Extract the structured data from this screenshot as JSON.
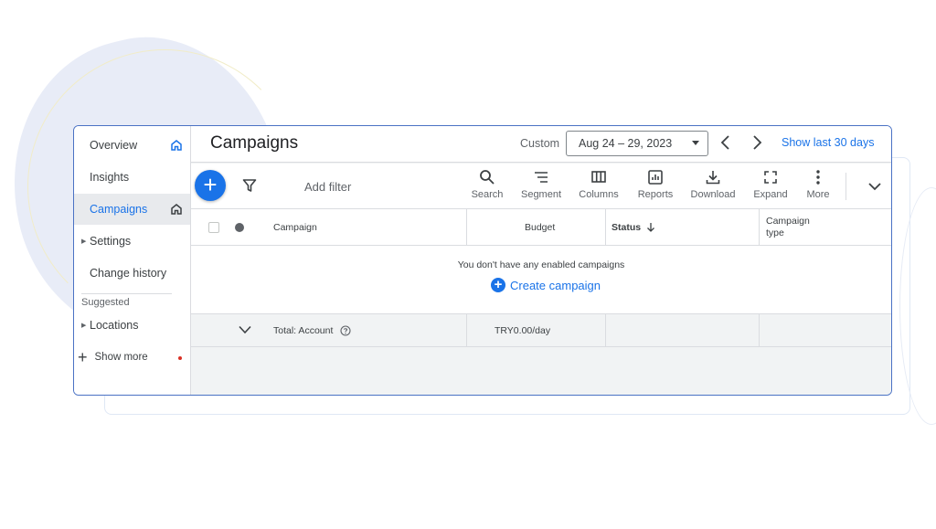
{
  "sidebar": {
    "items": [
      {
        "label": "Overview"
      },
      {
        "label": "Insights"
      },
      {
        "label": "Campaigns"
      },
      {
        "label": "Settings"
      },
      {
        "label": "Change history"
      }
    ],
    "suggested_label": "Suggested",
    "suggested_items": [
      {
        "label": "Locations"
      }
    ],
    "show_more": "Show more"
  },
  "header": {
    "title": "Campaigns",
    "range_type": "Custom",
    "date_range": "Aug 24 – 29, 2023",
    "show_last": "Show last 30 days"
  },
  "toolbar": {
    "add_filter": "Add filter",
    "tools": [
      {
        "label": "Search",
        "icon": "search-icon"
      },
      {
        "label": "Segment",
        "icon": "segment-icon"
      },
      {
        "label": "Columns",
        "icon": "columns-icon"
      },
      {
        "label": "Reports",
        "icon": "reports-icon"
      },
      {
        "label": "Download",
        "icon": "download-icon"
      },
      {
        "label": "Expand",
        "icon": "expand-icon"
      },
      {
        "label": "More",
        "icon": "more-vert-icon"
      }
    ]
  },
  "table": {
    "columns": {
      "campaign": "Campaign",
      "budget": "Budget",
      "status": "Status",
      "campaign_type_line1": "Campaign",
      "campaign_type_line2": "type"
    },
    "empty_message": "You don't have any enabled campaigns",
    "create_campaign": "Create campaign",
    "total": {
      "label": "Total: Account",
      "budget": "TRY0.00/day"
    }
  },
  "colors": {
    "accent": "#1a73e8",
    "window_border": "#4a72c4"
  }
}
